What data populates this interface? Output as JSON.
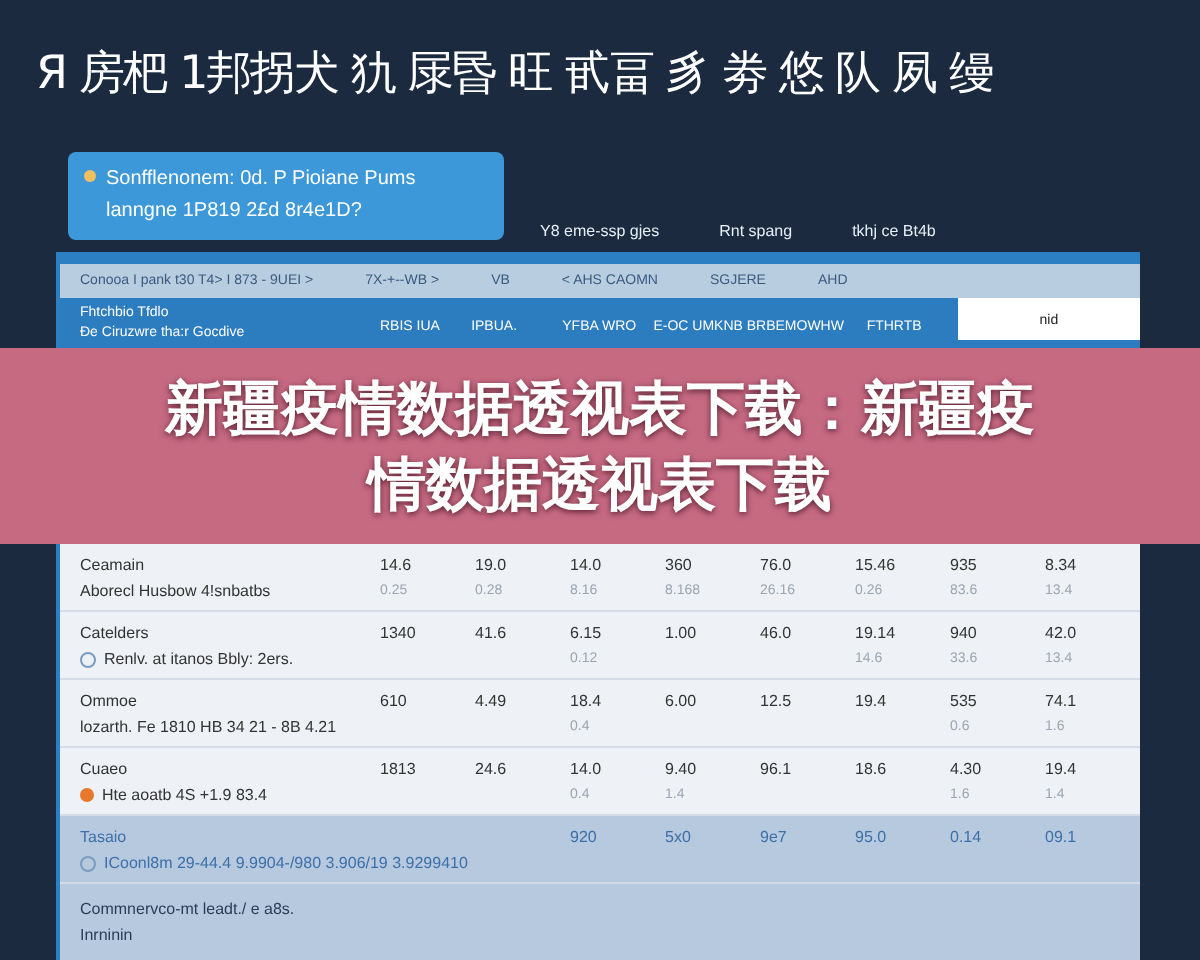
{
  "headline": "Я 房杷 1邦拐犬 犰 㞗昬 旺 甙畐 豸 劵 悠 队 夙 缦",
  "info_card": {
    "line_1": "Sonfflenonem: 0d. P Pioiane Pums",
    "line_2": "lanngne 1P819 2£d 8r4e1D?"
  },
  "meta": [
    "Y8 eme-ssp gjes",
    "Rnt spang",
    "tkhj ce Bt4b"
  ],
  "filters": [
    "Conooa I pank t30 T4> I 873 - 9UEI >",
    "7X-+--WB >",
    "VB",
    "< AHS CAOMN",
    "SGJERE",
    "AHD"
  ],
  "header": {
    "label_1": "Fhtchbio Tfdlo",
    "label_2": "Ðe Ciruzwre tha:r Gocdive",
    "columns": [
      "RBIS IUA",
      "IPBUA.",
      "YFBA WRO",
      "E-OC UMKNB BRB",
      "EMOWHW",
      "FTHRTB"
    ],
    "last": "nid"
  },
  "banner": "新疆疫情数据透视表下载：新疆疫情数据透视表下载",
  "rows": [
    {
      "name": "Ceamain",
      "note": "Aborecl Husbow 4!snbatbs",
      "selected": false,
      "cells": [
        {
          "value": "14.6",
          "sub": "0.25"
        },
        {
          "value": "19.0",
          "sub": "0.28"
        },
        {
          "value": "14.0",
          "sub": "8.16"
        },
        {
          "value": "360",
          "sub": "8.168"
        },
        {
          "value": "76.0",
          "sub": "26.16"
        },
        {
          "value": "15.46",
          "sub": "0.26"
        },
        {
          "value": "935",
          "sub": "83.6"
        },
        {
          "value": "8.34",
          "sub": "13.4"
        }
      ]
    },
    {
      "name": "Catelders",
      "note": "Renlv. at itanos Bbly: 2ers.",
      "kind": "circle",
      "selected": false,
      "cells": [
        {
          "value": "1340"
        },
        {
          "value": "41.6"
        },
        {
          "value": "6.15",
          "sub": "0.12"
        },
        {
          "value": "1.00"
        },
        {
          "value": "46.0"
        },
        {
          "value": "19.14",
          "sub": "14.6"
        },
        {
          "value": "940",
          "sub": "33.6"
        },
        {
          "value": "42.0",
          "sub": "13.4"
        }
      ]
    },
    {
      "name": "Ommoe",
      "note": "lozarth. Fe 1810 HB 34 21 - 8B 4.21",
      "selected": false,
      "cells": [
        {
          "value": "610"
        },
        {
          "value": "4.49"
        },
        {
          "value": "18.4",
          "sub": "0.4"
        },
        {
          "value": "6.00"
        },
        {
          "value": "12.5"
        },
        {
          "value": "19.4"
        },
        {
          "value": "535",
          "sub": "0.6"
        },
        {
          "value": "74.1",
          "sub": "1.6"
        }
      ]
    },
    {
      "name": "Cuaeo",
      "note": "Hte aoatb 4S +1.9 83.4",
      "kind": "dot",
      "selected": false,
      "cells": [
        {
          "value": "1813"
        },
        {
          "value": "24.6"
        },
        {
          "value": "14.0",
          "sub": "0.4"
        },
        {
          "value": "9.40",
          "sub": "1.4"
        },
        {
          "value": "96.1"
        },
        {
          "value": "18.6"
        },
        {
          "value": "4.30",
          "sub": "1.6"
        },
        {
          "value": "19.4",
          "sub": "1.4"
        }
      ]
    },
    {
      "name": "Tasaio",
      "note": "ICoonl8m 29-44.4 9.9904-/980 3.906/19 3.9299410",
      "kind": "circle",
      "selected": true,
      "cells": [
        {},
        {},
        {
          "value": "920"
        },
        {
          "value": "5x0"
        },
        {
          "value": "9e7"
        },
        {
          "value": "95.0"
        },
        {
          "value": "0.14"
        },
        {
          "value": "09.1"
        }
      ]
    }
  ],
  "footer": {
    "line_1": "Commnervco-mt leadt./ e a8s.",
    "line_2": "Inrninin"
  }
}
